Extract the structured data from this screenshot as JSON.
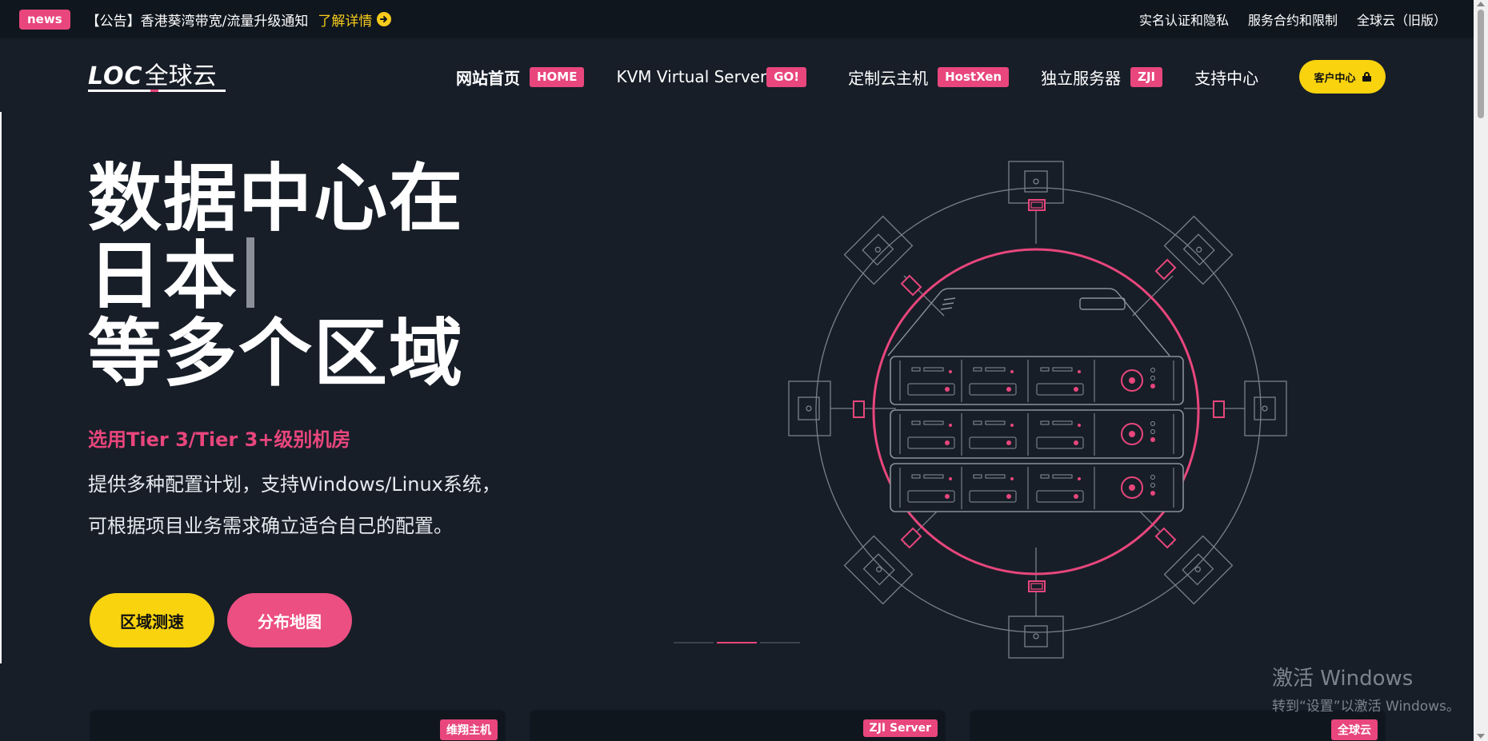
{
  "announcement": {
    "badge": "news",
    "text": "【公告】香港葵湾带宽/流量升级通知",
    "link_label": "了解详情",
    "link_icon": "arrow-right-circle-icon"
  },
  "top_links": [
    "实名认证和隐私",
    "服务合约和限制",
    "全球云（旧版）"
  ],
  "logo": {
    "latin": "LOC",
    "cn": "全球云"
  },
  "nav": [
    {
      "label": "网站首页",
      "tag": "HOME"
    },
    {
      "label": "KVM Virtual Server",
      "tag": "GO!"
    },
    {
      "label": "定制云主机",
      "tag": "HostXen"
    },
    {
      "label": "独立服务器",
      "tag": "ZJI"
    },
    {
      "label": "支持中心",
      "tag": ""
    }
  ],
  "client_center": {
    "label": "客户中心",
    "icon": "lock-icon"
  },
  "hero": {
    "line1": "数据中心在",
    "line2": "日本",
    "line3": "等多个区域",
    "subtitle": "选用Tier 3/Tier 3+级别机房",
    "desc1": "提供多种配置计划，支持Windows/Linux系统，",
    "desc2": "可根据项目业务需求确立适合自己的配置。",
    "btn_speed": "区域测速",
    "btn_map": "分布地图"
  },
  "slider": {
    "count": 3,
    "active_index": 1
  },
  "cards": [
    {
      "tag": "维翔主机"
    },
    {
      "tag": "ZJI Server"
    },
    {
      "tag": "全球云"
    }
  ],
  "watermark": {
    "line1": "激活 Windows",
    "line2": "转到“设置”以激活 Windows。"
  },
  "colors": {
    "background": "#171e28",
    "topbar": "#10161e",
    "accent_pink": "#e8467c",
    "accent_yellow": "#f8d30e"
  }
}
